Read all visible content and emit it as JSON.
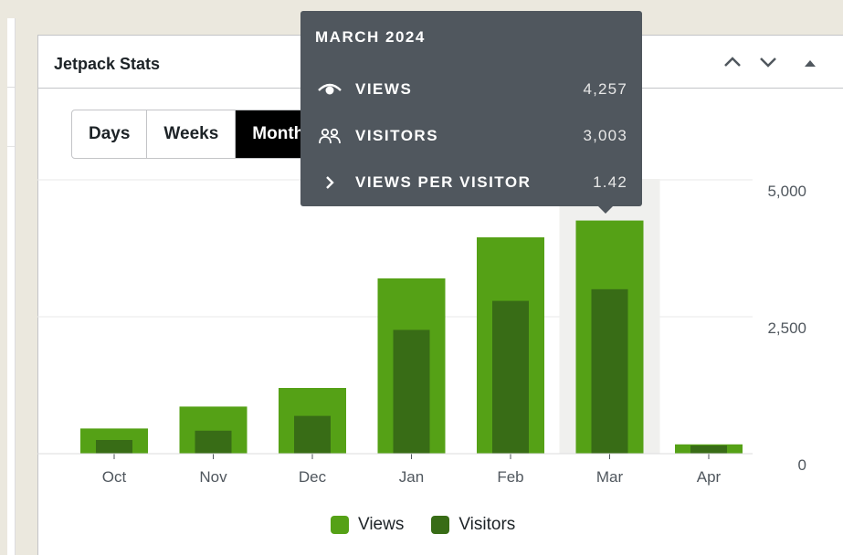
{
  "widget": {
    "title": "Jetpack Stats"
  },
  "periods": [
    "Days",
    "Weeks",
    "Months"
  ],
  "active_period": "Months",
  "tooltip": {
    "title": "MARCH 2024",
    "rows": [
      {
        "icon": "eye-icon",
        "label": "VIEWS",
        "value": "4,257"
      },
      {
        "icon": "people-icon",
        "label": "VISITORS",
        "value": "3,003"
      },
      {
        "icon": "chevron-right-icon",
        "label": "VIEWS PER VISITOR",
        "value": "1.42"
      }
    ]
  },
  "legend": [
    {
      "label": "Views",
      "color": "#55a116"
    },
    {
      "label": "Visitors",
      "color": "#386c16"
    }
  ],
  "chart_data": {
    "type": "bar",
    "categories": [
      "Oct",
      "Nov",
      "Dec",
      "Jan",
      "Feb",
      "Mar",
      "Apr"
    ],
    "series": [
      {
        "name": "Views",
        "values": [
          460,
          860,
          1200,
          3200,
          3950,
          4257,
          170
        ]
      },
      {
        "name": "Visitors",
        "values": [
          250,
          420,
          690,
          2260,
          2790,
          3003,
          150
        ]
      }
    ],
    "y_ticks": [
      "5,000",
      "2,500",
      "0"
    ],
    "ylim": [
      0,
      5000
    ],
    "highlighted": "Mar",
    "colors": {
      "views": "#55a116",
      "visitors": "#386c16",
      "highlight": "#f0f0ee",
      "grid": "#e8e8e8"
    }
  }
}
